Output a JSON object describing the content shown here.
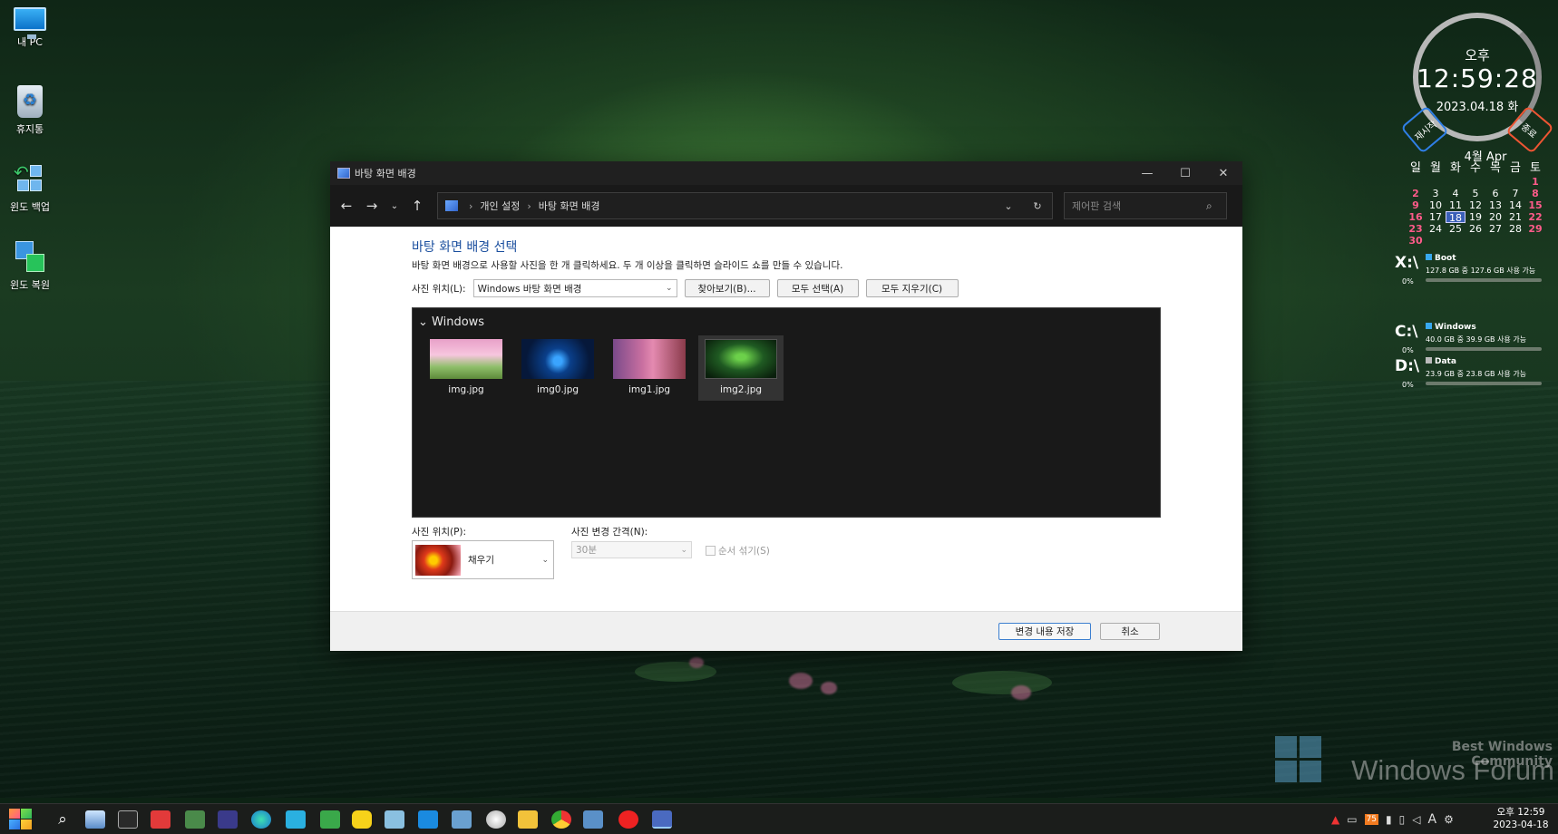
{
  "desktop": {
    "icons": [
      {
        "label": "내 PC"
      },
      {
        "label": "휴지통"
      },
      {
        "label": "윈도 백업"
      },
      {
        "label": "윈도 복원"
      }
    ]
  },
  "clock_widget": {
    "ampm": "오후",
    "time": "12:59:28",
    "date": "2023.04.18 화",
    "restart_label": "재시작",
    "quit_label": "종료"
  },
  "calendar": {
    "title": "4월 Apr",
    "weekdays": [
      "일",
      "월",
      "화",
      "수",
      "목",
      "금",
      "토"
    ],
    "leading_blanks": 6,
    "days": 30,
    "today": 18,
    "red_days": [
      1,
      2,
      8,
      9,
      15,
      16,
      22,
      23,
      29,
      30
    ]
  },
  "drives": [
    {
      "letter": "X:\\",
      "name": "Boot",
      "size": "127.8 GB 중  127.6 GB 사용 가능",
      "percent": "0%",
      "used_fraction": 0.0
    },
    {
      "letter": "C:\\",
      "name": "Windows",
      "size": "40.0 GB 중  39.9 GB 사용 가능",
      "percent": "0%",
      "used_fraction": 0.0
    },
    {
      "letter": "D:\\",
      "name": "Data",
      "size": "23.9 GB 중  23.8 GB 사용 가능",
      "percent": "0%",
      "used_fraction": 0.0
    }
  ],
  "watermark": {
    "tagline": "Best Windows Community",
    "name": "Windows Forum"
  },
  "window": {
    "title": "바탕 화면 배경",
    "breadcrumb": [
      "개인 설정",
      "바탕 화면 배경"
    ],
    "search_placeholder": "제어판 검색",
    "heading": "바탕 화면 배경 선택",
    "description": "바탕 화면 배경으로 사용할 사진을 한 개 클릭하세요. 두 개 이상을 클릭하면 슬라이드 쇼를 만들 수 있습니다.",
    "picture_location_label": "사진 위치(L):",
    "picture_location_value": "Windows 바탕 화면 배경",
    "browse_label": "찾아보기(B)...",
    "select_all_label": "모두 선택(A)",
    "clear_all_label": "모두 지우기(C)",
    "group_name": "Windows",
    "images": [
      {
        "name": "img.jpg",
        "selected": false
      },
      {
        "name": "img0.jpg",
        "selected": false
      },
      {
        "name": "img1.jpg",
        "selected": false
      },
      {
        "name": "img2.jpg",
        "selected": true
      }
    ],
    "picture_position_label": "사진 위치(P):",
    "picture_position_value": "채우기",
    "change_interval_label": "사진 변경 간격(N):",
    "change_interval_value": "30분",
    "shuffle_label": "순서 섞기(S)",
    "save_label": "변경 내용 저장",
    "cancel_label": "취소"
  },
  "taskbar": {
    "time": "오후 12:59",
    "date": "2023-04-18",
    "ime": "A"
  },
  "colors": {
    "heading": "#1a4e9e",
    "calendar_red": "#ff5b8a",
    "accent": "#3c7fd0"
  }
}
